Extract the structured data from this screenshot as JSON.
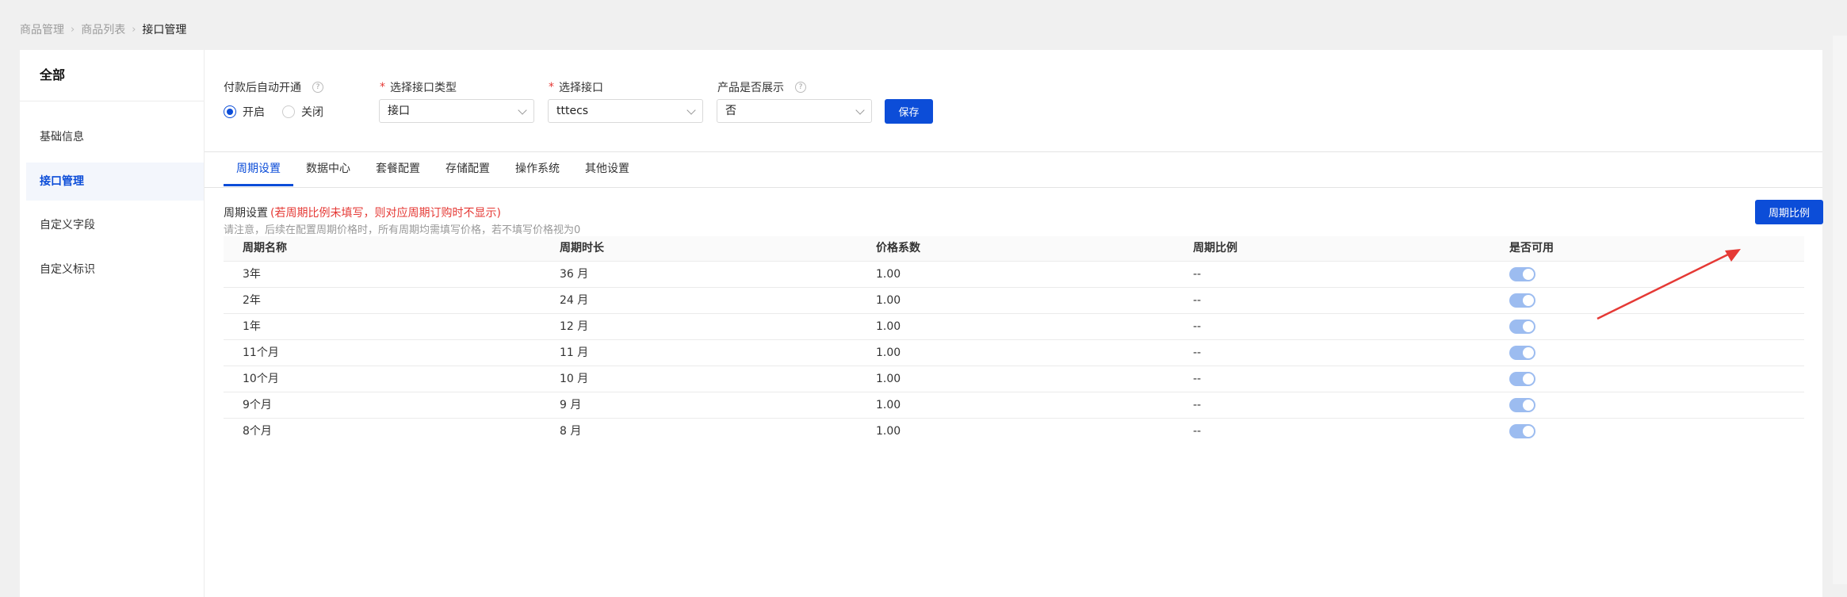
{
  "breadcrumb": [
    "商品管理",
    "商品列表",
    "接口管理"
  ],
  "sidebar": {
    "all_label": "全部",
    "items": [
      {
        "label": "基础信息",
        "active": false
      },
      {
        "label": "接口管理",
        "active": true
      },
      {
        "label": "自定义字段",
        "active": false
      },
      {
        "label": "自定义标识",
        "active": false
      }
    ]
  },
  "form": {
    "auto_open": {
      "label": "付款后自动开通",
      "options": [
        "开启",
        "关闭"
      ],
      "selected": "开启"
    },
    "interface_type": {
      "label": "选择接口类型",
      "value": "接口"
    },
    "interface": {
      "label": "选择接口",
      "value": "tttecs"
    },
    "display": {
      "label": "产品是否展示",
      "value": "否"
    },
    "save_label": "保存"
  },
  "tabs": [
    "周期设置",
    "数据中心",
    "套餐配置",
    "存储配置",
    "操作系统",
    "其他设置"
  ],
  "active_tab": "周期设置",
  "period": {
    "title": "周期设置",
    "title_note": "(若周期比例未填写，则对应周期订购时不显示)",
    "note": "请注意，后续在配置周期价格时，所有周期均需填写价格，若不填写价格视为0",
    "ratio_button": "周期比例"
  },
  "table": {
    "headers": [
      "周期名称",
      "周期时长",
      "价格系数",
      "周期比例",
      "是否可用"
    ],
    "rows": [
      {
        "name": "3年",
        "duration": "36 月",
        "coef": "1.00",
        "ratio": "--",
        "enabled": true
      },
      {
        "name": "2年",
        "duration": "24 月",
        "coef": "1.00",
        "ratio": "--",
        "enabled": true
      },
      {
        "name": "1年",
        "duration": "12 月",
        "coef": "1.00",
        "ratio": "--",
        "enabled": true
      },
      {
        "name": "11个月",
        "duration": "11 月",
        "coef": "1.00",
        "ratio": "--",
        "enabled": true
      },
      {
        "name": "10个月",
        "duration": "10 月",
        "coef": "1.00",
        "ratio": "--",
        "enabled": true
      },
      {
        "name": "9个月",
        "duration": "9 月",
        "coef": "1.00",
        "ratio": "--",
        "enabled": true
      },
      {
        "name": "8个月",
        "duration": "8 月",
        "coef": "1.00",
        "ratio": "--",
        "enabled": true
      }
    ]
  },
  "colors": {
    "primary": "#0c4dd8",
    "required": "#e53935",
    "arrow": "#e53935",
    "toggle_on": "#9cbcf0"
  }
}
